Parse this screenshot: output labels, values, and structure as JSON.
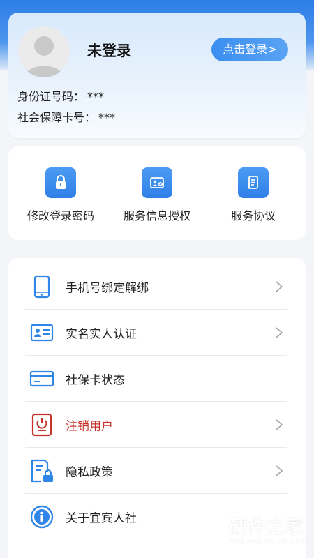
{
  "profile": {
    "status": "未登录",
    "login_button": "点击登录>",
    "id_label": "身份证号码：",
    "id_value": "***",
    "card_label": "社会保障卡号：",
    "card_value": "***"
  },
  "quick_actions": [
    {
      "label": "修改登录密码",
      "icon": "lock-icon"
    },
    {
      "label": "服务信息授权",
      "icon": "id-card-icon"
    },
    {
      "label": "服务协议",
      "icon": "document-icon"
    }
  ],
  "menu": [
    {
      "label": "手机号绑定解绑",
      "icon": "phone-icon",
      "chevron": true
    },
    {
      "label": "实名实人认证",
      "icon": "id-badge-icon",
      "chevron": true
    },
    {
      "label": "社保卡状态",
      "icon": "card-icon",
      "chevron": false
    },
    {
      "label": "注销用户",
      "icon": "power-icon",
      "chevron": true,
      "color": "#c6322a"
    },
    {
      "label": "隐私政策",
      "icon": "privacy-lock-icon",
      "chevron": true
    },
    {
      "label": "关于宜宾人社",
      "icon": "info-icon",
      "chevron": false
    }
  ],
  "watermark": {
    "title": "硬件之家",
    "subtitle": "YING JIAN ZHI JIA.COM"
  },
  "colors": {
    "accent": "#3b8ef0",
    "danger": "#c6322a",
    "background": "#f3f5f9"
  }
}
